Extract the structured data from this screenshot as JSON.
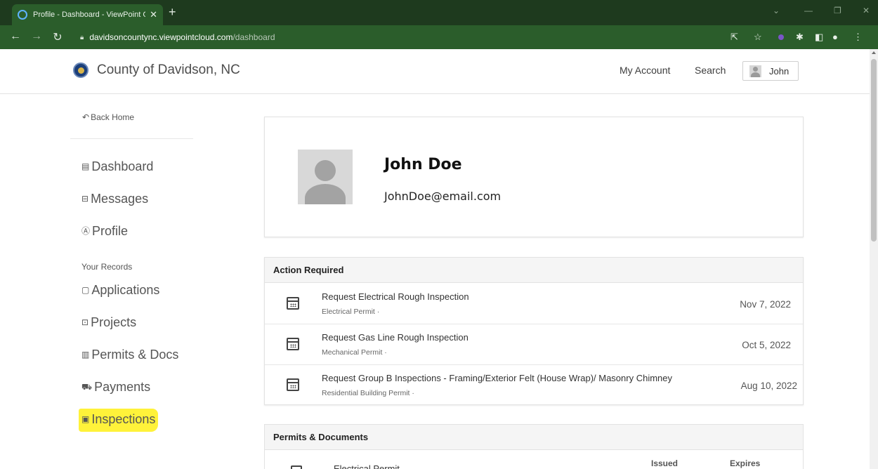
{
  "browser": {
    "tab_title": "Profile - Dashboard - ViewPoint C",
    "tab_close": "✕",
    "new_tab": "+",
    "url_host": "davidsoncountync.viewpointcloud.com",
    "url_path": "/dashboard"
  },
  "header": {
    "county_name": "County of Davidson, NC",
    "my_account": "My Account",
    "search": "Search",
    "user_name": "John"
  },
  "sidebar": {
    "back_home": "Back Home",
    "items": [
      {
        "label": "Dashboard",
        "icon": "dashboard-icon"
      },
      {
        "label": "Messages",
        "icon": "inbox-icon"
      },
      {
        "label": "Profile",
        "icon": "profile-icon"
      }
    ],
    "records_heading": "Your Records",
    "records": [
      {
        "label": "Applications",
        "icon": "document-icon"
      },
      {
        "label": "Projects",
        "icon": "briefcase-icon"
      },
      {
        "label": "Permits & Docs",
        "icon": "permit-icon"
      },
      {
        "label": "Payments",
        "icon": "cart-icon"
      },
      {
        "label": "Inspections",
        "icon": "clipboard-icon"
      }
    ],
    "highlight_color": "#fff23a"
  },
  "profile": {
    "name": "John Doe",
    "email": "JohnDoe@email.com"
  },
  "action_required": {
    "heading": "Action Required",
    "rows": [
      {
        "title": "Request Electrical Rough Inspection",
        "subtitle": "Electrical Permit ·",
        "date": "Nov 7, 2022"
      },
      {
        "title": "Request Gas Line Rough Inspection",
        "subtitle": "Mechanical Permit ·",
        "date": "Oct 5, 2022"
      },
      {
        "title": "Request Group B Inspections - Framing/Exterior Felt (House Wrap)/ Masonry Chimney",
        "subtitle": "Residential Building Permit ·",
        "date": "Aug 10, 2022"
      }
    ]
  },
  "permits": {
    "heading": "Permits & Documents",
    "col_issued": "Issued",
    "col_expires": "Expires",
    "first_row_name": "Electrical Permit"
  },
  "colors": {
    "chrome_dark": "#1e3a1e",
    "chrome": "#2b5d2b"
  }
}
